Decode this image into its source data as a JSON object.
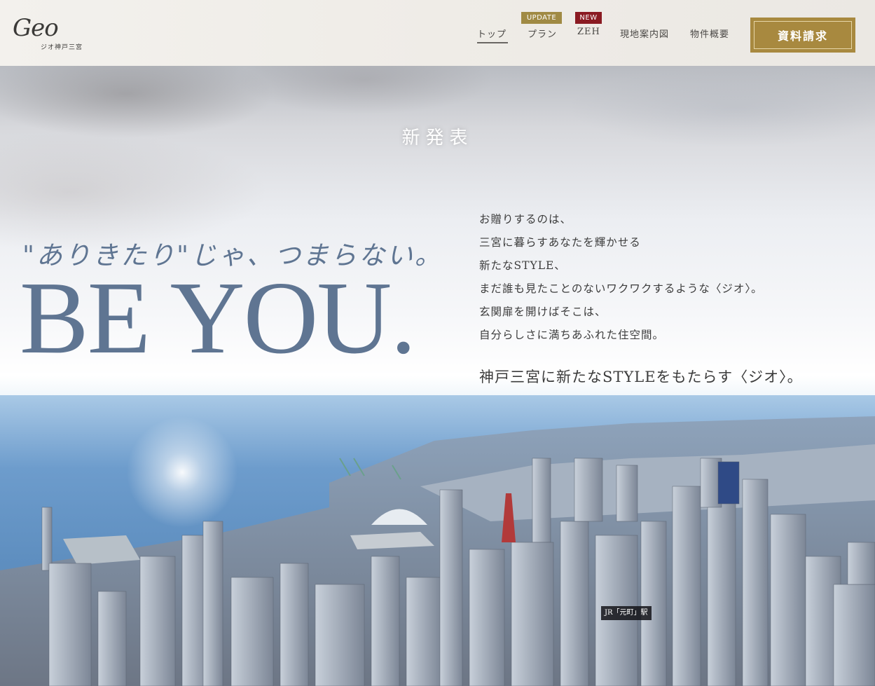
{
  "header": {
    "logo_script": "Geo",
    "logo_subtitle": "ジオ神戸三宮",
    "nav": [
      {
        "label": "トップ",
        "badge": ""
      },
      {
        "label": "プラン",
        "badge": "UPDATE"
      },
      {
        "label": "ZEH",
        "badge": "NEW"
      },
      {
        "label": "現地案内図",
        "badge": ""
      },
      {
        "label": "物件概要",
        "badge": ""
      }
    ],
    "cta_label": "資料請求"
  },
  "hero": {
    "announce": "新発表",
    "catch": "\"ありきたり\"じゃ、つまらない。",
    "headline": "BE YOU.",
    "body": [
      "お贈りするのは、",
      "三宮に暮らすあなたを輝かせる",
      "新たなSTYLE、",
      "まだ誰も見たことのないワクワクするような〈ジオ〉。",
      "玄関扉を開けばそこは、",
      "自分らしさに満ちあふれた住空間。"
    ],
    "tagline": "神戸三宮に新たなSTYLEをもたらす〈ジオ〉。",
    "station_label": "JR「元町」駅"
  },
  "colors": {
    "accent_gold": "#a8893f",
    "badge_new": "#8a1a22",
    "headline_blue": "#5f7592"
  }
}
